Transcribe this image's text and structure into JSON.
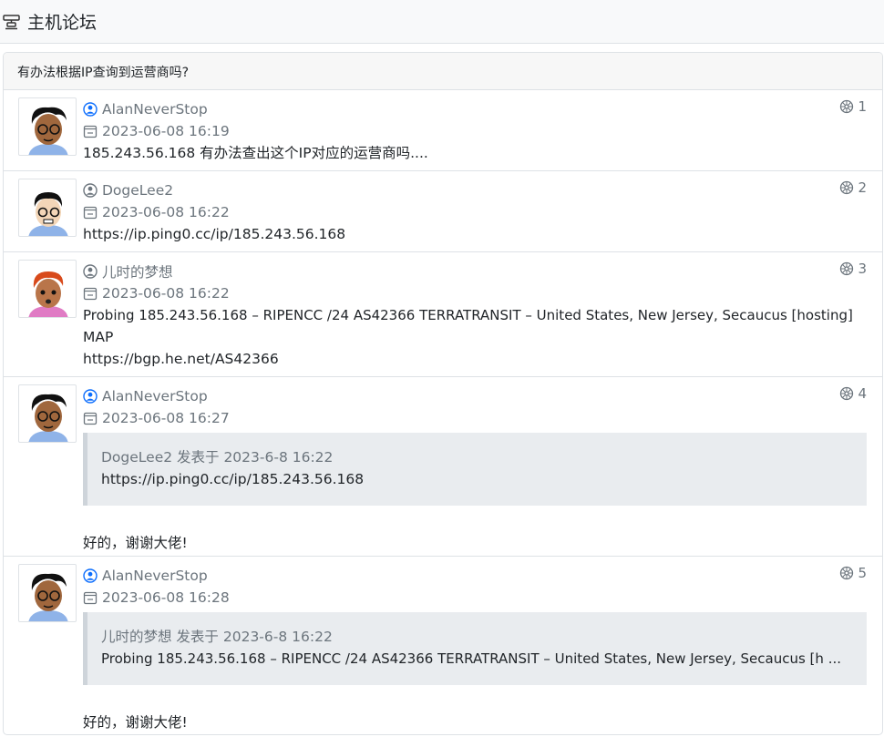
{
  "site": {
    "title": "主机论坛",
    "icon": "forum-logo-icon"
  },
  "thread": {
    "title": "有办法根据IP查询到运营商吗?"
  },
  "posts": [
    {
      "floor": "1",
      "author": "AlanNeverStop",
      "author_icon": "user-circle-blue-icon",
      "time": "2023-06-08 16:19",
      "lines": [
        "185.243.56.168  有办法查出这个IP对应的运营商吗...."
      ]
    },
    {
      "floor": "2",
      "author": "DogeLee2",
      "author_icon": "user-circle-gray-icon",
      "time": "2023-06-08 16:22",
      "lines": [
        "https://ip.ping0.cc/ip/185.243.56.168"
      ]
    },
    {
      "floor": "3",
      "author": "儿时的梦想",
      "author_icon": "user-circle-gray-icon",
      "time": "2023-06-08 16:22",
      "lines": [
        "Probing 185.243.56.168 – RIPENCC /24 AS42366 TERRATRANSIT – United States, New Jersey, Secaucus [hosting]",
        "MAP",
        "https://bgp.he.net/AS42366"
      ]
    },
    {
      "floor": "4",
      "author": "AlanNeverStop",
      "author_icon": "user-circle-blue-icon",
      "time": "2023-06-08 16:27",
      "quote": {
        "head": "DogeLee2 发表于 2023-6-8 16:22",
        "body": "https://ip.ping0.cc/ip/185.243.56.168"
      },
      "reply": "好的，谢谢大佬!"
    },
    {
      "floor": "5",
      "author": "AlanNeverStop",
      "author_icon": "user-circle-blue-icon",
      "time": "2023-06-08 16:28",
      "quote": {
        "head": "儿时的梦想 发表于 2023-6-8 16:22",
        "body": "Probing 185.243.56.168 – RIPENCC /24 AS42366 TERRATRANSIT – United States, New Jersey, Secaucus [h ..."
      },
      "reply": "好的，谢谢大佬!"
    }
  ],
  "colors": {
    "author_blue": "#0d6efd",
    "muted": "#6c757d",
    "quote_bg": "#e9ecef",
    "border": "#dee2e6"
  }
}
